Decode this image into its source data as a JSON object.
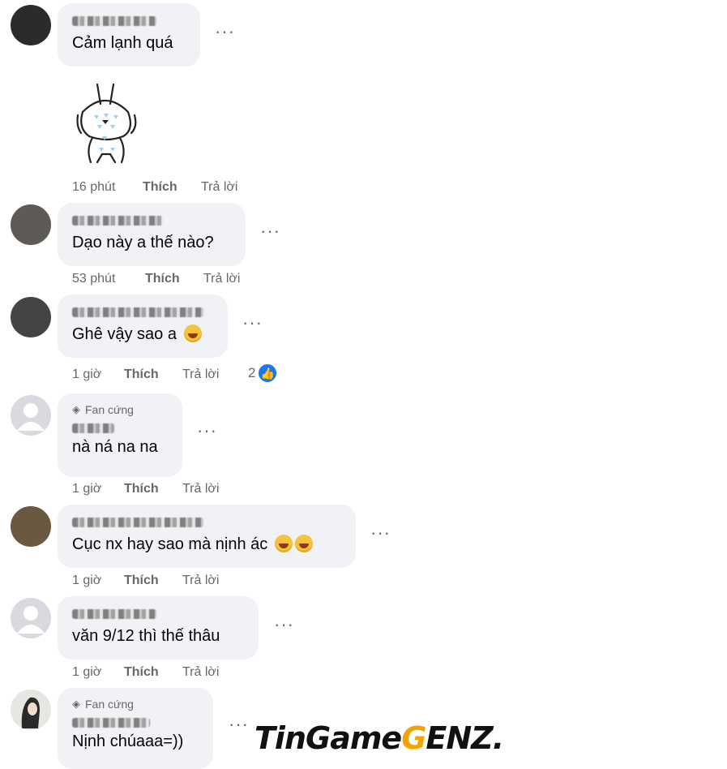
{
  "comments": [
    {
      "text": "Cảm lạnh quá",
      "time": "16 phút",
      "like": "Thích",
      "reply": "Trả lời"
    },
    {
      "text": "Dạo này a thế nào?",
      "time": "53 phút",
      "like": "Thích",
      "reply": "Trả lời"
    },
    {
      "text": "Ghê vậy sao a",
      "time": "1 giờ",
      "like": "Thích",
      "reply": "Trả lời",
      "reactions": "2"
    },
    {
      "badge": "Fan cứng",
      "text": "nà ná na na",
      "time": "1 giờ",
      "like": "Thích",
      "reply": "Trả lời"
    },
    {
      "text": "Cục nx hay sao mà nịnh ác",
      "time": "1 giờ",
      "like": "Thích",
      "reply": "Trả lời"
    },
    {
      "text": "văn 9/12 thì thế thâu",
      "time": "1 giờ",
      "like": "Thích",
      "reply": "Trả lời"
    },
    {
      "badge": "Fan cứng",
      "text": "Nịnh chúaaa=))"
    }
  ],
  "more_label": "···",
  "watermark": {
    "part1": "TinGame",
    "part2": "G",
    "part3": "ENZ."
  },
  "icons": {
    "more": "more-options-icon",
    "like": "like-thumb-icon",
    "badge": "diamond-icon"
  },
  "colors": {
    "bubble": "#f0f2f5",
    "meta": "#65676b",
    "like_blue": "#1877f2"
  }
}
